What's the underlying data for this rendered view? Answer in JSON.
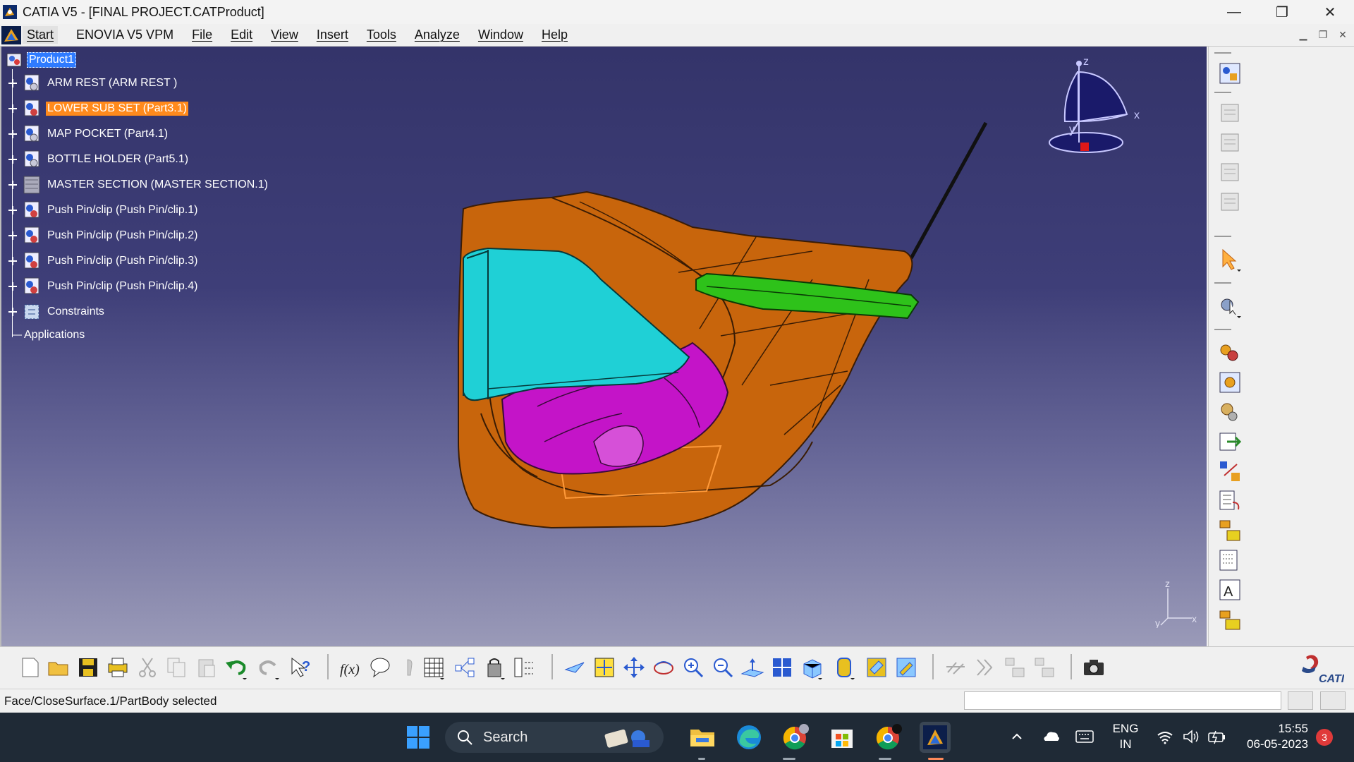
{
  "window": {
    "title": "CATIA V5 - [FINAL PROJECT.CATProduct]",
    "minimize": "—",
    "restore": "❐",
    "close": "✕"
  },
  "menu": {
    "items": [
      "Start",
      "ENOVIA V5 VPM",
      "File",
      "Edit",
      "View",
      "Insert",
      "Tools",
      "Analyze",
      "Window",
      "Help"
    ],
    "mdi_min": "▁",
    "mdi_restore": "❐",
    "mdi_close": "✕"
  },
  "tree": {
    "root": "Product1",
    "items": [
      {
        "label": "ARM REST  (ARM REST )",
        "icon": "part-icon"
      },
      {
        "label": "LOWER SUB SET (Part3.1)",
        "icon": "part-icon"
      },
      {
        "label": "MAP POCKET (Part4.1)",
        "icon": "part-icon"
      },
      {
        "label": "BOTTLE HOLDER  (Part5.1)",
        "icon": "part-icon"
      },
      {
        "label": "MASTER SECTION (MASTER SECTION.1)",
        "icon": "part-icon"
      },
      {
        "label": "Push Pin/clip (Push Pin/clip.1)",
        "icon": "part-icon"
      },
      {
        "label": "Push Pin/clip (Push Pin/clip.2)",
        "icon": "part-icon"
      },
      {
        "label": "Push Pin/clip (Push Pin/clip.3)",
        "icon": "part-icon"
      },
      {
        "label": "Push Pin/clip (Push Pin/clip.4)",
        "icon": "part-icon"
      },
      {
        "label": "Constraints",
        "icon": "constraints-icon"
      }
    ],
    "applications": "Applications"
  },
  "compass": {
    "z": "z",
    "x": "x",
    "y": "y"
  },
  "axis": {
    "z": "z",
    "x": "x",
    "y": "y"
  },
  "status": {
    "text": "Face/CloseSurface.1/PartBody selected"
  },
  "brand": {
    "ds_logo": "CATIA"
  },
  "taskbar": {
    "search": "Search",
    "lang_top": "ENG",
    "lang_bottom": "IN",
    "time": "15:55",
    "date": "06-05-2023",
    "notifications": "3"
  },
  "colors": {
    "viewport_top": "#34346a",
    "viewport_bottom": "#9a9ab8",
    "part_orange": "#c8650c",
    "part_cyan": "#1fd0d6",
    "part_magenta": "#c414c8",
    "part_green": "#2ec21a",
    "selection_orange": "#ff8a1c",
    "selection_blue": "#2f7bff"
  }
}
